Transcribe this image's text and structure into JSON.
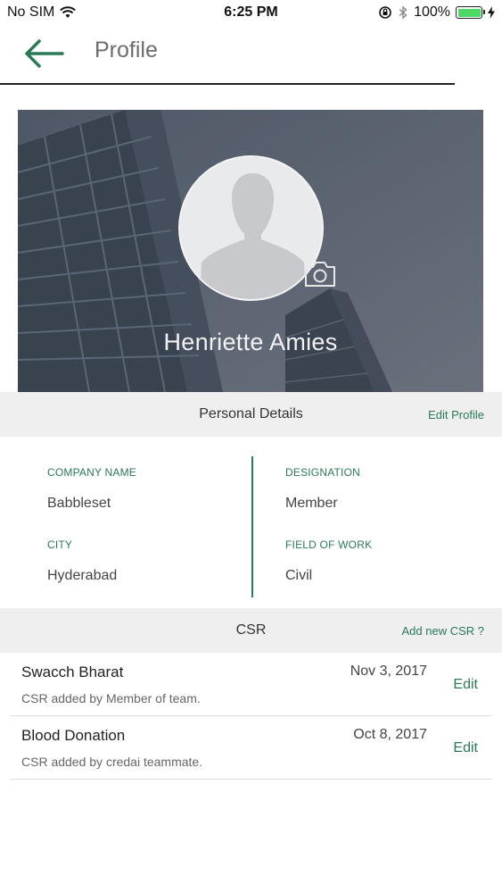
{
  "status_bar": {
    "carrier": "No SIM",
    "time": "6:25 PM",
    "battery": "100%",
    "icons": [
      "wifi-icon",
      "orientation-lock-icon",
      "bluetooth-icon",
      "battery-icon",
      "charging-icon"
    ]
  },
  "header": {
    "title": "Profile",
    "back_icon": "arrow-left-icon"
  },
  "profile": {
    "name": "Henriette Amies",
    "avatar_icon": "person-silhouette-icon",
    "camera_icon": "camera-icon"
  },
  "personal_details": {
    "section_title": "Personal Details",
    "edit_label": "Edit Profile",
    "company_label": "COMPANY NAME",
    "company_value": "Babbleset",
    "designation_label": "DESIGNATION",
    "designation_value": "Member",
    "city_label": "CITY",
    "city_value": "Hyderabad",
    "field_label": "FIELD OF WORK",
    "field_value": "Civil"
  },
  "csr": {
    "section_title": "CSR",
    "add_label": "Add new CSR ?",
    "items": [
      {
        "title": "Swacch Bharat",
        "subtitle": "CSR added by Member of team.",
        "date": "Nov 3, 2017",
        "edit": "Edit"
      },
      {
        "title": "Blood Donation",
        "subtitle": "CSR added by credai teammate.",
        "date": "Oct 8, 2017",
        "edit": "Edit"
      }
    ]
  },
  "colors": {
    "accent": "#2a7a55",
    "section_bg": "#efefef",
    "banner_overlay": "#5b6573",
    "battery_green": "#4cd964"
  }
}
